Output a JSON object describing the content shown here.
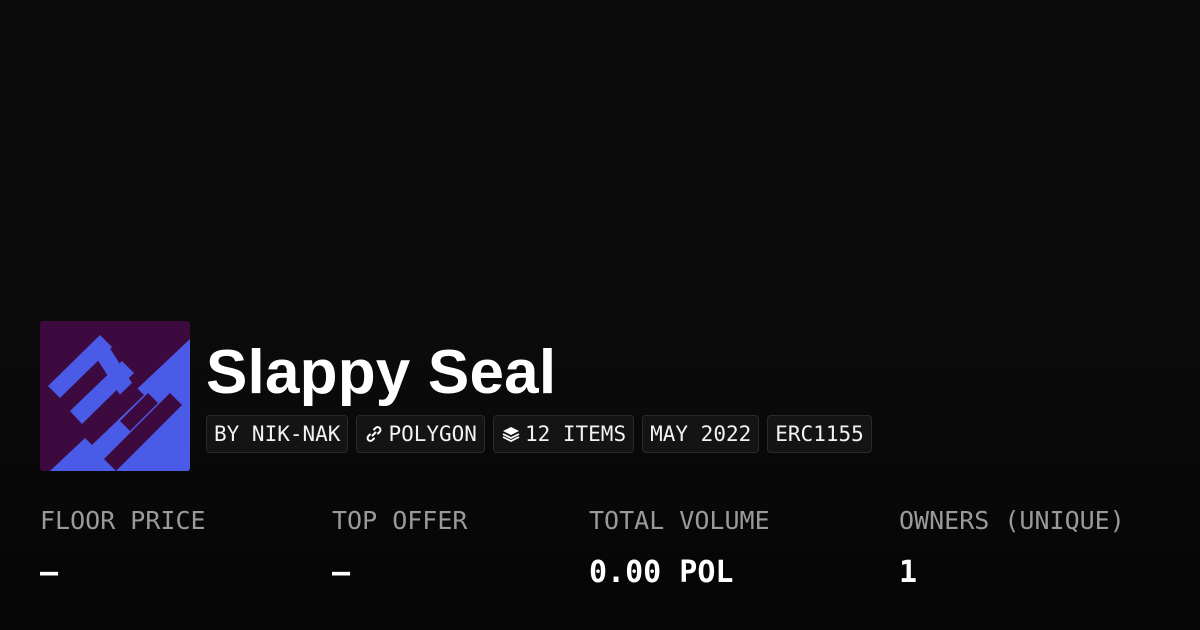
{
  "collection": {
    "title": "Slappy Seal",
    "tags": [
      {
        "icon": "",
        "label": "BY NIK-NAK"
      },
      {
        "icon": "link-icon",
        "label": "POLYGON"
      },
      {
        "icon": "layers-icon",
        "label": "12 ITEMS"
      },
      {
        "icon": "",
        "label": "MAY 2022"
      },
      {
        "icon": "",
        "label": "ERC1155"
      }
    ]
  },
  "stats": [
    {
      "label": "FLOOR PRICE",
      "value": "–"
    },
    {
      "label": "TOP OFFER",
      "value": "–"
    },
    {
      "label": "TOTAL VOLUME",
      "value": "0.00 POL"
    },
    {
      "label": "OWNERS (UNIQUE)",
      "value": "1"
    }
  ],
  "colors": {
    "background": "#0b0b0b",
    "avatar_dark": "#3d0a40",
    "avatar_blue": "#4a5be8",
    "label_grey": "#9a9a9a"
  }
}
